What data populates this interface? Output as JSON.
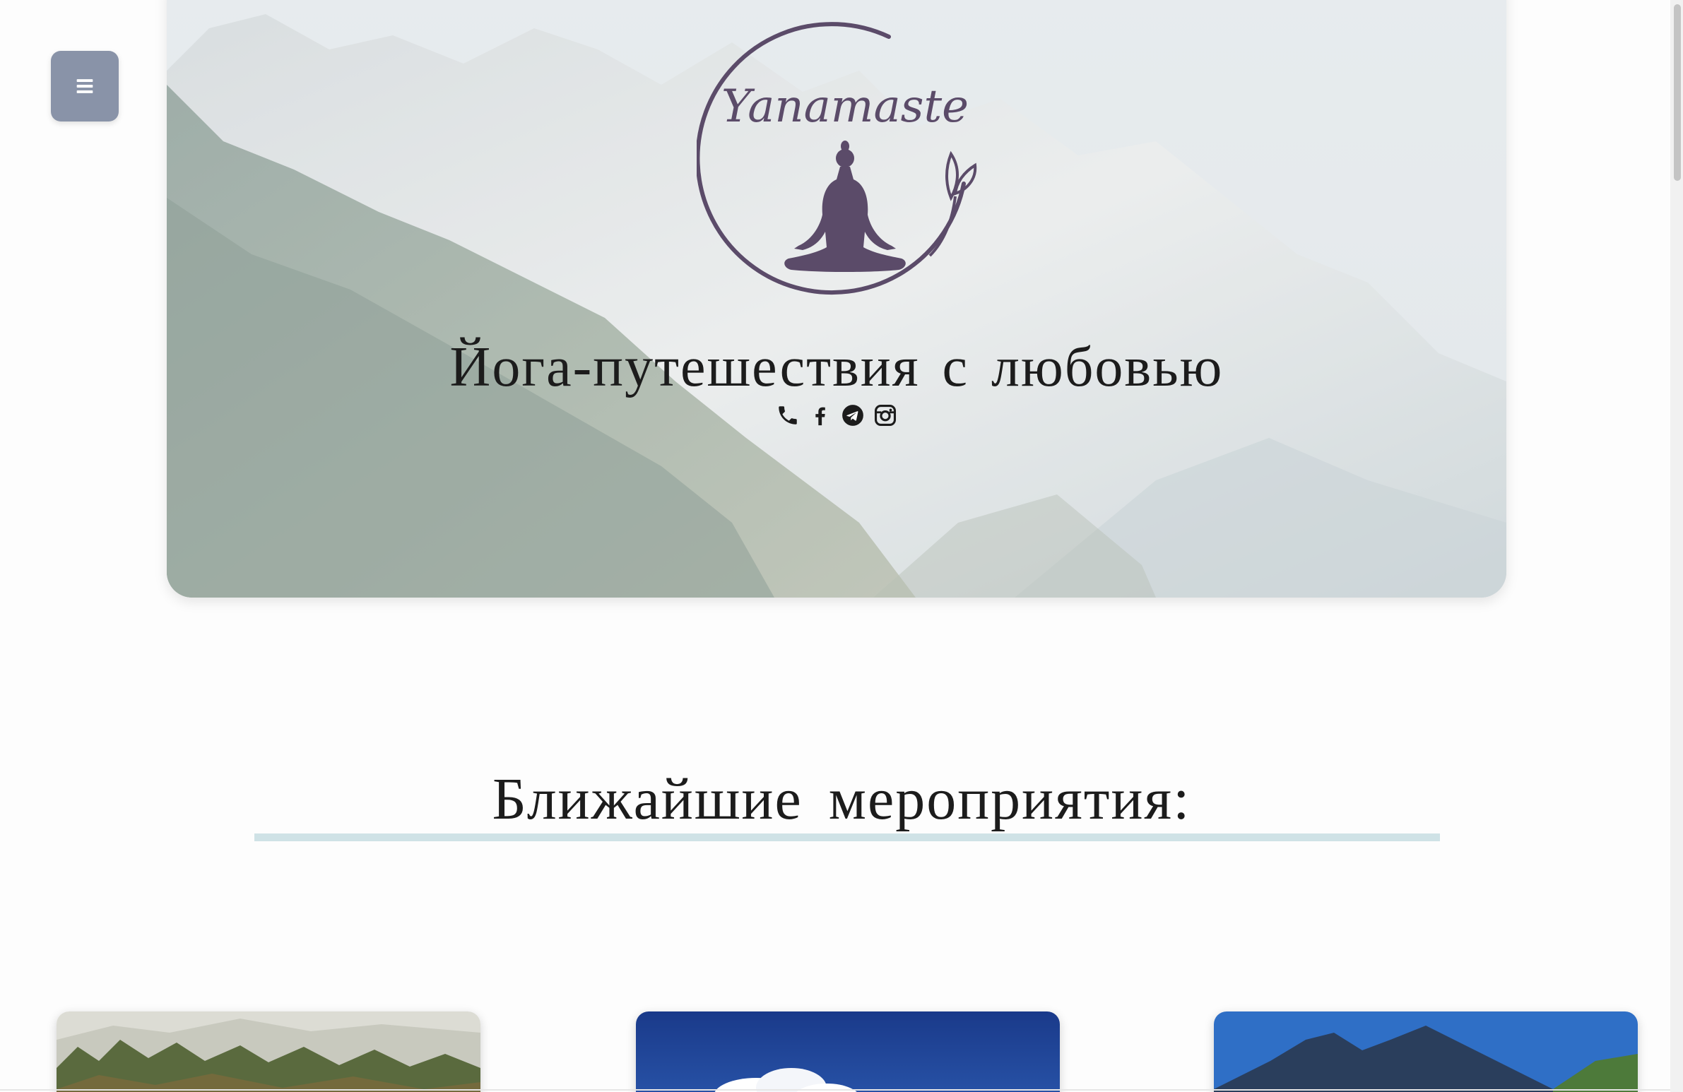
{
  "menu": {
    "icon": "hamburger-icon"
  },
  "hero": {
    "logo_text": "Yanamaste",
    "tagline": "Йога-путешествия с любовью",
    "socials": [
      {
        "icon": "phone-icon"
      },
      {
        "icon": "facebook-icon"
      },
      {
        "icon": "telegram-icon"
      },
      {
        "icon": "instagram-icon"
      }
    ]
  },
  "events": {
    "heading": "Ближайшие мероприятия:"
  },
  "colors": {
    "menu_button": "#8993a8",
    "logo": "#5b4b69",
    "underline": "#cfe2e6",
    "text": "#1c1c1c"
  }
}
